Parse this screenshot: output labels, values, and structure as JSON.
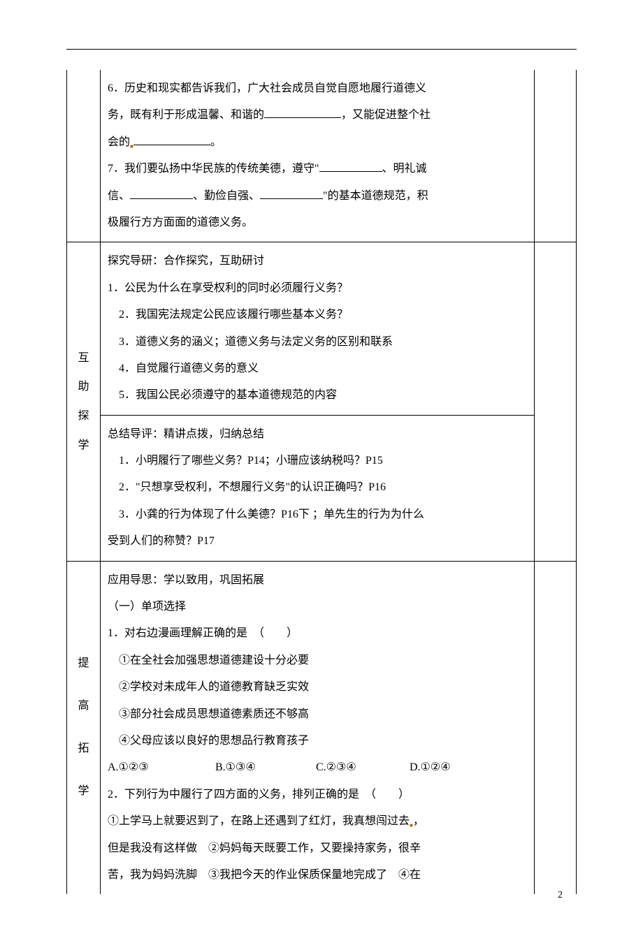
{
  "top": {
    "l1a": "6．历史和现实都告诉我们，广大社会成员自觉自愿地履行道德义",
    "l1b_a": "务，既有利于形成温馨、和谐的",
    "l1b_b": "，又能促进整个社",
    "l1c_a": "会的",
    "l1c_b": "。",
    "l2a_a": "7．我们要弘扬中华民族的传统美德，遵守\"",
    "l2a_b": "、明礼诚",
    "l2b_a": "信、",
    "l2b_b": "、勤俭自强、",
    "l2b_c": "\"的基本道德规范，积",
    "l2c": "极履行方方面面的道德义务。"
  },
  "sec1": {
    "label": [
      "互",
      "助",
      "探",
      "学"
    ],
    "h1": "探究导研：合作探究，互助研讨",
    "q1": "1．公民为什么在享受权利的同时必须履行义务？",
    "q2": "2．我国宪法规定公民应该履行哪些基本义务？",
    "q3": "3．道德义务的涵义；道德义务与法定义务的区别和联系",
    "q4": "4．自觉履行道德义务的意义",
    "q5": "5．我国公民必须遵守的基本道德规范的内容",
    "h2": "总结导评：精讲点拨，归纳总结",
    "p1": "1．小明履行了哪些义务？P14；小珊应该纳税吗？P15",
    "p2": "2．\"只想享受权利，不想履行义务\"的认识正确吗？P16",
    "p3a": "3．小龚的行为体现了什么美德？P16下 ；单先生的行为为什么",
    "p3b": "受到人们的称赞？P17"
  },
  "sec2": {
    "label": [
      "提",
      "高",
      "拓",
      "学"
    ],
    "h1": "应用导思：学以致用，巩固拓展",
    "sub": "（一）单项选择",
    "q1": "1．对右边漫画理解正确的是　（　　）",
    "q1a": "①在全社会加强思想道德建设十分必要",
    "q1b": "②学校对未成年人的道德教育缺乏实效",
    "q1c": "③部分社会成员思想道德素质还不够高",
    "q1d": "④父母应该以良好的思想品行教育孩子",
    "optA": "A.①②③",
    "optB": "B.①③④",
    "optC": "C.②③④",
    "optD": "D.①②④",
    "q2": "2．下列行为中履行了四方面的义务，排列正确的是　（　　）",
    "q2a_a": "①上学马上就要迟到了，在路上还遇到了红灯，我真想闯过去",
    "q2a_b": "，",
    "q2b": "但是我没有这样做　②妈妈每天既要工作，又要操持家务，很辛",
    "q2c": "苦，我为妈妈洗脚　③我把今天的作业保质保量地完成了　④在"
  },
  "page_number": "2"
}
